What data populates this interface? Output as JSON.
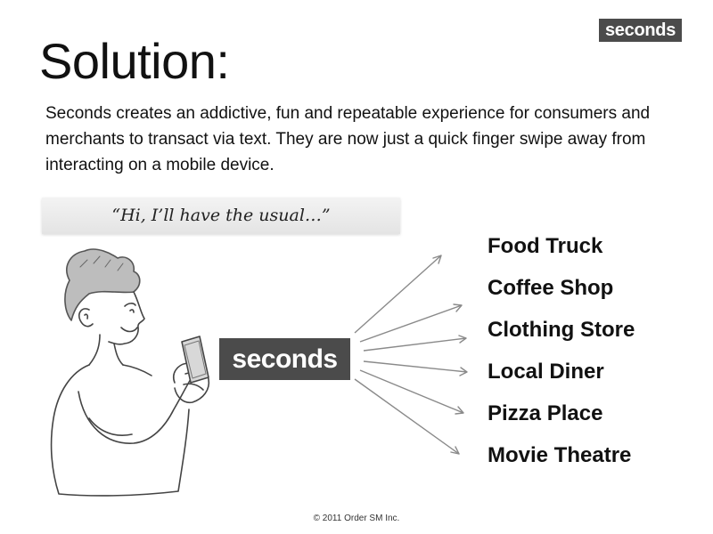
{
  "brand": {
    "name": "seconds",
    "badge_color": "#4b4b4b",
    "badge_text_color": "#ffffff"
  },
  "slide": {
    "title": "Solution:",
    "body": "Seconds creates an addictive, fun and repeatable experience for consumers and merchants to transact via text.  They are now just a quick finger swipe away from interacting on a mobile device.",
    "quote": "“Hi, I’ll have the usual…”"
  },
  "illustration": {
    "subject": "person-holding-phone-sketch",
    "icon": "person-with-phone-icon"
  },
  "destinations": [
    "Food Truck",
    "Coffee Shop",
    "Clothing Store",
    "Local Diner",
    "Pizza Place",
    "Movie Theatre"
  ],
  "footer": {
    "copyright": "© 2011 Order SM Inc."
  }
}
